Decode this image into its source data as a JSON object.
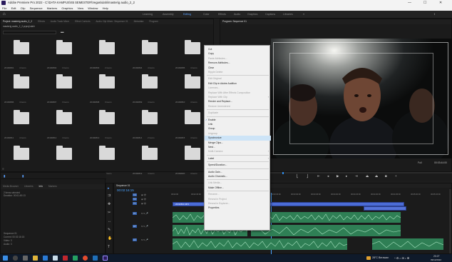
{
  "window": {
    "title": "Adobe Premiere Pro 2022 - C:\\DATA KAMPUS\\S5 SEMESTER\\Vegas\\ulahi\\masterig audio_2_2",
    "controls": [
      "—",
      "☐",
      "✕"
    ]
  },
  "menubar": [
    "File",
    "Edit",
    "Clip",
    "Sequence",
    "Markers",
    "Graphics",
    "View",
    "Window",
    "Help"
  ],
  "workspaces": [
    {
      "label": "Learning",
      "active": false
    },
    {
      "label": "Assembly",
      "active": false
    },
    {
      "label": "Editing",
      "active": true
    },
    {
      "label": "Color",
      "active": false
    },
    {
      "label": "Effects",
      "active": false
    },
    {
      "label": "Audio",
      "active": false
    },
    {
      "label": "Graphics",
      "active": false
    },
    {
      "label": "Captions",
      "active": false
    },
    {
      "label": "Libraries",
      "active": false
    }
  ],
  "project_panel": {
    "tabs": [
      "Project: masterig audio_2_2",
      "Effects",
      "Audio Track Mixer",
      "Effect Controls",
      "Audio Clip Mixer: Sequence 01",
      "Metadata",
      "Program"
    ],
    "path": "masterig audio_2_2.prproj\\ulahi",
    "bins": [
      {
        "name": "20190801",
        "count": "4 items"
      },
      {
        "name": "20190802",
        "count": "3 items"
      },
      {
        "name": "20190803",
        "count": "2 items"
      },
      {
        "name": "20190804",
        "count": "4 items"
      },
      {
        "name": "20190805",
        "count": "4 items"
      },
      {
        "name": "20190806",
        "count": "4 items"
      },
      {
        "name": "20190807",
        "count": "3 items"
      },
      {
        "name": "20190808",
        "count": "3 items"
      },
      {
        "name": "20190809",
        "count": "4 items"
      },
      {
        "name": "20190810",
        "count": "4 items"
      },
      {
        "name": "20190811",
        "count": "4 items"
      },
      {
        "name": "20190812",
        "count": "4 items"
      },
      {
        "name": "20190813",
        "count": "3 items"
      },
      {
        "name": "20190814",
        "count": "2 items"
      },
      {
        "name": "20190815",
        "count": "4 items"
      },
      {
        "name": "20190816",
        "count": "4 items"
      },
      {
        "name": "20190817",
        "count": "4 items"
      },
      {
        "name": "20190818",
        "count": "4 items"
      },
      {
        "name": "20190819",
        "count": "4 items"
      },
      {
        "name": "20190820",
        "count": "4 items"
      }
    ]
  },
  "context_menu": {
    "items": [
      {
        "label": "Cut",
        "disabled": false
      },
      {
        "label": "Copy",
        "disabled": false
      },
      {
        "label": "Paste Attributes...",
        "disabled": true
      },
      {
        "label": "Remove Attributes...",
        "disabled": false
      },
      {
        "label": "Clear",
        "disabled": false
      },
      {
        "label": "Ripple Delete",
        "disabled": true
      },
      {
        "sep": true
      },
      {
        "label": "Edit Original",
        "disabled": true
      },
      {
        "label": "Edit Clip in Adobe Audition",
        "disabled": false
      },
      {
        "label": "Licenses...",
        "disabled": true
      },
      {
        "label": "Replace With After Effects Composition",
        "disabled": true
      },
      {
        "label": "Replace With Clip",
        "disabled": true,
        "submenu": true
      },
      {
        "label": "Render and Replace...",
        "disabled": false
      },
      {
        "label": "Restore Unrendered",
        "disabled": true
      },
      {
        "sep": true
      },
      {
        "label": "Duplicate",
        "disabled": true
      },
      {
        "sep": true
      },
      {
        "label": "Enable",
        "disabled": false,
        "checked": true
      },
      {
        "label": "Link",
        "disabled": false
      },
      {
        "label": "Group",
        "disabled": false
      },
      {
        "label": "Ungroup",
        "disabled": true
      },
      {
        "label": "Synchronize",
        "disabled": false,
        "highlighted": true
      },
      {
        "label": "Merge Clips...",
        "disabled": false
      },
      {
        "label": "Nest...",
        "disabled": false
      },
      {
        "label": "Multi-Camera",
        "disabled": true,
        "submenu": true
      },
      {
        "sep": true
      },
      {
        "label": "Label",
        "disabled": false,
        "submenu": true
      },
      {
        "sep": true
      },
      {
        "label": "Speed/Duration...",
        "disabled": false
      },
      {
        "sep": true
      },
      {
        "label": "Audio Gain...",
        "disabled": false
      },
      {
        "label": "Audio Channels...",
        "disabled": false
      },
      {
        "sep": true
      },
      {
        "label": "Link Media...",
        "disabled": true
      },
      {
        "label": "Make Offline...",
        "disabled": false
      },
      {
        "sep": true
      },
      {
        "label": "Rename...",
        "disabled": true
      },
      {
        "label": "Reveal in Project",
        "disabled": true
      },
      {
        "label": "Reveal in Explorer...",
        "disabled": true
      },
      {
        "label": "Properties",
        "disabled": false
      }
    ]
  },
  "program_monitor": {
    "title": "Program: Sequence 01",
    "fit": "Full",
    "timecode": "00:03:44:00"
  },
  "timeline": {
    "tab": "Sequence 01",
    "timecode": "00:02:16:15",
    "ruler": [
      "00:02:00",
      "00:02:15:00",
      "00:02:30:00",
      "00:02:45:00",
      "00:03:00:00",
      "00:03:15:00",
      "00:03:30:00",
      "00:03:45:00",
      "00:04:00:00",
      "00:04:15:00",
      "00:04:30:00",
      "00:04:45:00",
      "00:05:00:00",
      "00:05:15:00"
    ],
    "tracks": [
      "V3",
      "V2",
      "V1",
      "A1",
      "A2",
      "A3"
    ],
    "clip_label": "20190801.MP4"
  },
  "bottom_left_panel": {
    "tabs": [
      "Media Browser",
      "Libraries",
      "Info",
      "Markers"
    ],
    "lines": [
      "2 items selected",
      "Duration: 00:01:45:13",
      "",
      "Sequence 01",
      "Current: 00:02:16:15",
      "Video: 3",
      "Audio: 3"
    ]
  },
  "taskbar": {
    "weather": "28°C Berawan",
    "time": "20:27",
    "date": "09/12/2022"
  },
  "colors": {
    "accent": "#2d8ceb",
    "clip_video": "#4b6cd6",
    "clip_audio": "#3ca36b",
    "highlight": "#cde4f7"
  }
}
